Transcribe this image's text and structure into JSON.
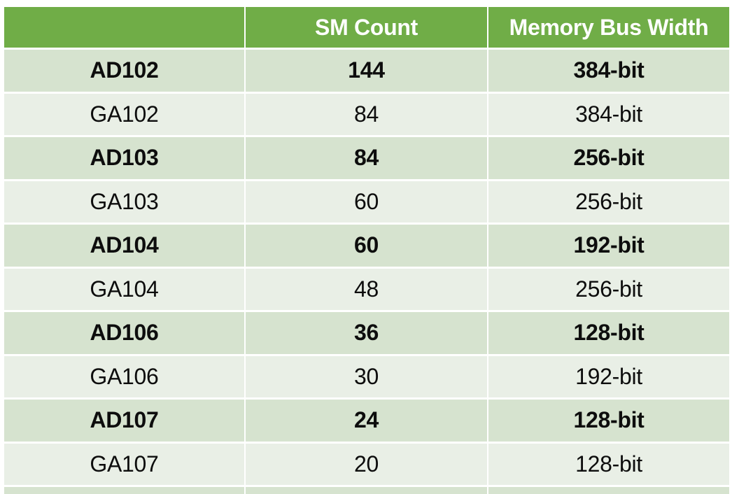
{
  "table": {
    "headers": [
      "",
      "SM Count",
      "Memory Bus Width"
    ],
    "rows": [
      {
        "gpu": "AD102",
        "sm_count": "144",
        "bus_width": "384-bit",
        "highlighted": true
      },
      {
        "gpu": "GA102",
        "sm_count": "84",
        "bus_width": "384-bit",
        "highlighted": false
      },
      {
        "gpu": "AD103",
        "sm_count": "84",
        "bus_width": "256-bit",
        "highlighted": true
      },
      {
        "gpu": "GA103",
        "sm_count": "60",
        "bus_width": "256-bit",
        "highlighted": false
      },
      {
        "gpu": "AD104",
        "sm_count": "60",
        "bus_width": "192-bit",
        "highlighted": true
      },
      {
        "gpu": "GA104",
        "sm_count": "48",
        "bus_width": "256-bit",
        "highlighted": false
      },
      {
        "gpu": "AD106",
        "sm_count": "36",
        "bus_width": "128-bit",
        "highlighted": true
      },
      {
        "gpu": "GA106",
        "sm_count": "30",
        "bus_width": "192-bit",
        "highlighted": false
      },
      {
        "gpu": "AD107",
        "sm_count": "24",
        "bus_width": "128-bit",
        "highlighted": true
      },
      {
        "gpu": "GA107",
        "sm_count": "20",
        "bus_width": "128-bit",
        "highlighted": false
      }
    ]
  },
  "colors": {
    "header_bg": "#70AD47",
    "header_text": "#FFFFFF",
    "highlight_row_bg": "#D6E3CF",
    "normal_row_bg": "#E9EFE6"
  }
}
